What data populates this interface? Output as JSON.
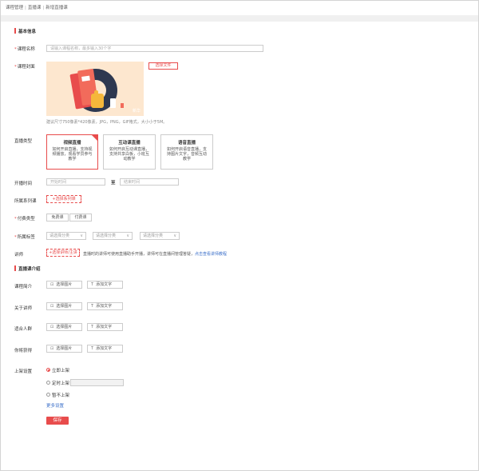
{
  "breadcrumb": [
    "课程管理",
    "直播课",
    "新增直播课"
  ],
  "sections": {
    "basic": "基本信息",
    "intro": "直播课介绍"
  },
  "fields": {
    "course_name": {
      "label": "课程名称",
      "placeholder": "请输入课程名称，最多输入30个字"
    },
    "cover": {
      "label": "课程封面",
      "button": "选择文件",
      "hint": "建议尺寸750像素*420像素，JPG，PNG，GIF格式，大小小于5M。",
      "badge": "新华"
    },
    "live_type": {
      "label": "直播类型",
      "options": [
        {
          "title": "视频直播",
          "desc": "如何开启直播，支持视频播放，观看学员参与教学",
          "selected": true
        },
        {
          "title": "互动课直播",
          "desc": "如何开启互动课直播，支持共享白板，小班互动教学",
          "selected": false
        },
        {
          "title": "语音直播",
          "desc": "如何开启语音直播，支持图片文字，音频互动教学",
          "selected": false
        }
      ]
    },
    "time": {
      "label": "开播时间",
      "start_placeholder": "开始时间",
      "sep": "至",
      "end_placeholder": "结束时间"
    },
    "series": {
      "label": "所属系列课",
      "button": "+选择系列课"
    },
    "pay_type": {
      "label": "付费类型",
      "options": [
        "免费课",
        "付费课"
      ]
    },
    "category": {
      "label": "所属标签",
      "selects": [
        "请选择分类",
        "请选择分类",
        "请选择分类"
      ]
    },
    "lecturer": {
      "label": "讲师",
      "button": "+选择讲师/主讲",
      "hint": "直播时的讲师可使用直播助手开播，讲师可在直播间管理答疑，",
      "link": "点击查看讲师教程"
    }
  },
  "intro_rows": [
    {
      "label": "课程简介",
      "image_btn": "选择图片",
      "text_btn": "添加文字"
    },
    {
      "label": "关于讲师",
      "image_btn": "选择图片",
      "text_btn": "添加文字"
    },
    {
      "label": "适合人群",
      "image_btn": "选择图片",
      "text_btn": "添加文字"
    },
    {
      "label": "你将获得",
      "image_btn": "选择图片",
      "text_btn": "添加文字"
    }
  ],
  "publish": {
    "label": "上架设置",
    "options": [
      "立即上架",
      "定时上架",
      "暂不上架"
    ],
    "selected": 0,
    "more": "更多设置"
  },
  "save_label": "保存",
  "colors": {
    "accent": "#e84c4c",
    "link": "#3b6fc9"
  }
}
